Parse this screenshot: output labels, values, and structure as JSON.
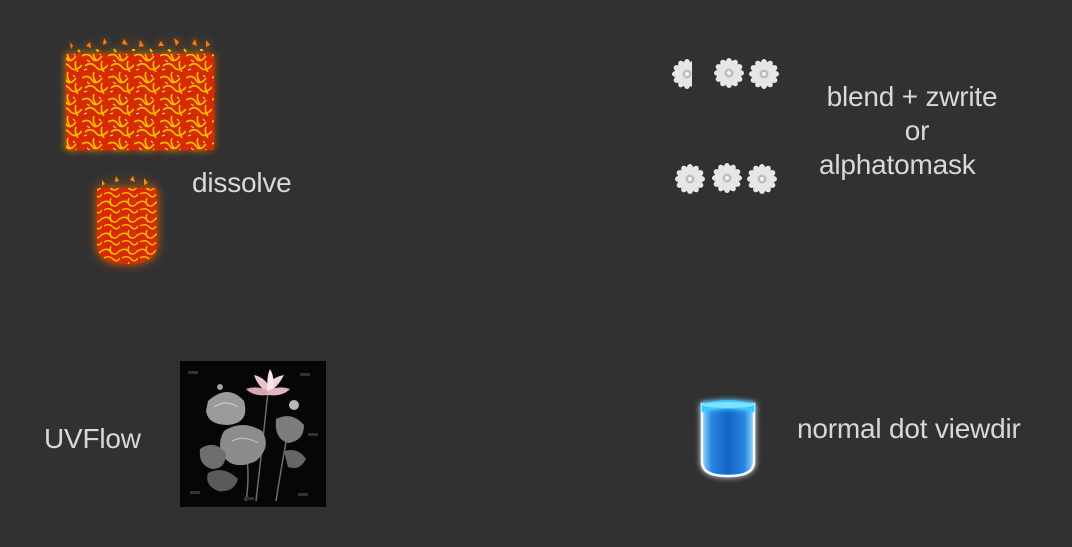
{
  "scene": {
    "background": "#313131",
    "text_color": "#d8d8d8"
  },
  "demos": {
    "dissolve": {
      "label": "dissolve",
      "colors": {
        "glow": "#ff3a00",
        "ember": "#ffb000",
        "core": "#ff5a10"
      },
      "icons": [
        "dissolve-plane-icon",
        "dissolve-capsule-icon"
      ]
    },
    "blend": {
      "label_lines": [
        "blend + zwrite",
        "or",
        "alphatomask"
      ],
      "flower_color": "#e8e8e8",
      "icon": "flower-sprite-icon"
    },
    "uvflow": {
      "label": "UVFlow",
      "icon": "lotus-texture-icon",
      "colors": {
        "background": "#050505",
        "petal": "#f3d6dc",
        "leaf": "#8a8a8a"
      }
    },
    "rim": {
      "label": "normal dot viewdir",
      "icon": "rim-glow-capsule-icon",
      "colors": {
        "top": "#35c8ff",
        "body": "#1a6fd0",
        "rim": "#ffffff"
      }
    }
  }
}
